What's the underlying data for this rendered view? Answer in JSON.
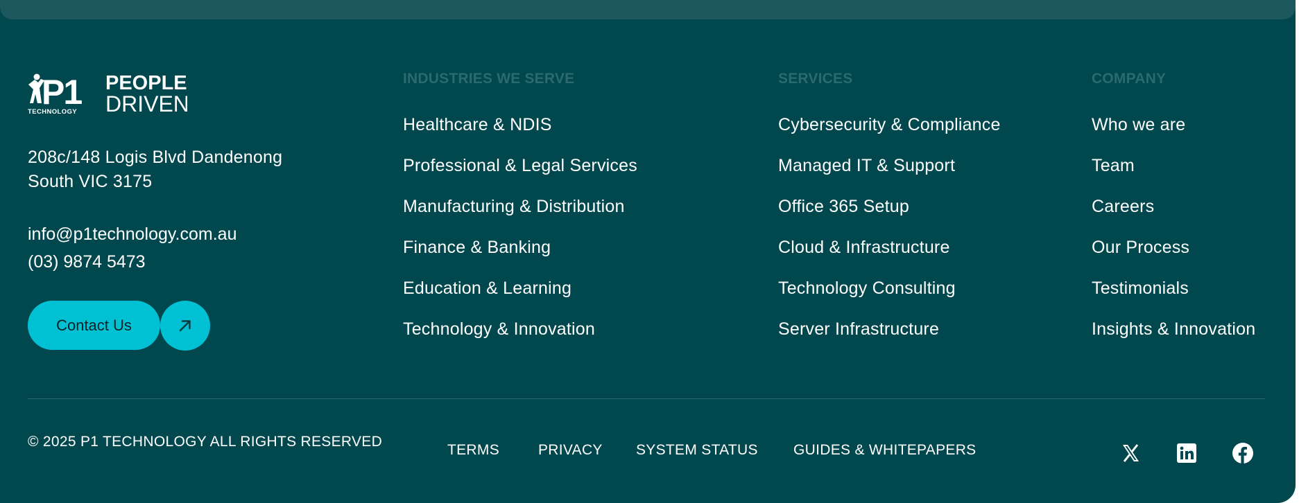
{
  "brand": {
    "logo_mark": "P1",
    "logo_sub": "TECHNOLOGY",
    "tagline_line1": "PEOPLE",
    "tagline_line2": "DRIVEN",
    "address_line1": "208c/148 Logis Blvd Dandenong",
    "address_line2": "South VIC 3175",
    "email": "info@p1technology.com.au",
    "phone": "(03) 9874 5473",
    "contact_label": "Contact Us"
  },
  "industries": {
    "heading": "INDUSTRIES WE SERVE",
    "items": [
      "Healthcare & NDIS",
      "Professional & Legal Services",
      "Manufacturing & Distribution",
      "Finance & Banking",
      "Education & Learning",
      "Technology & Innovation"
    ]
  },
  "services": {
    "heading": "SERVICES",
    "items": [
      "Cybersecurity & Compliance",
      "Managed IT & Support",
      "Office 365 Setup",
      "Cloud & Infrastructure",
      "Technology Consulting",
      "Server Infrastructure"
    ]
  },
  "company": {
    "heading": "COMPANY",
    "items": [
      "Who we are",
      "Team",
      "Careers",
      "Our Process",
      "Testimonials",
      "Insights & Innovation"
    ]
  },
  "bottom": {
    "copyright": "© 2025 P1 TECHNOLOGY ALL RIGHTS RESERVED",
    "links": [
      "TERMS",
      "PRIVACY",
      "SYSTEM STATUS",
      "GUIDES & WHITEPAPERS"
    ],
    "social_icons": [
      "x-icon",
      "linkedin-icon",
      "facebook-icon"
    ]
  },
  "colors": {
    "footer_bg": "#00474e",
    "top_band": "#1c585e",
    "accent": "#00c1d4",
    "heading": "#2a6a70",
    "text": "#ffffff"
  }
}
